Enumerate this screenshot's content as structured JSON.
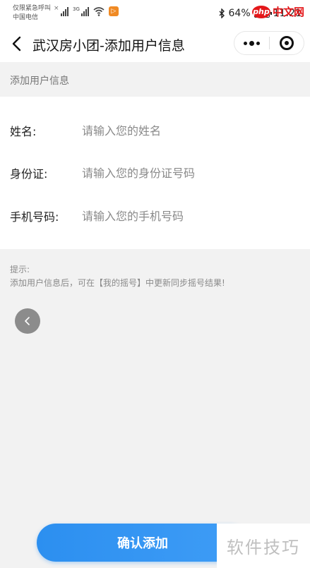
{
  "status_bar": {
    "emergency_text": "仅限紧急呼叫",
    "carrier": "中国电信",
    "sim_mark": "×",
    "signal_tag": "3G",
    "app_badge": "▷",
    "battery": "64%",
    "battery_level": 0.64,
    "time": "11:21"
  },
  "watermark_top": {
    "logo": "php",
    "text": "中文网"
  },
  "nav": {
    "title": "武汉房小团-添加用户信息"
  },
  "section": {
    "title": "添加用户信息"
  },
  "form": {
    "fields": [
      {
        "label": "姓名:",
        "placeholder": "请输入您的姓名"
      },
      {
        "label": "身份证:",
        "placeholder": "请输入您的身份证号码"
      },
      {
        "label": "手机号码:",
        "placeholder": "请输入您的手机号码"
      }
    ]
  },
  "hint": {
    "title": "提示:",
    "body": "添加用户信息后，可在【我的摇号】中更新同步摇号结果!"
  },
  "confirm": {
    "label": "确认添加"
  },
  "watermark_bottom": {
    "text": "软件技巧"
  },
  "colors": {
    "accent": "#2c8ff0",
    "php_red": "#e4171a"
  }
}
